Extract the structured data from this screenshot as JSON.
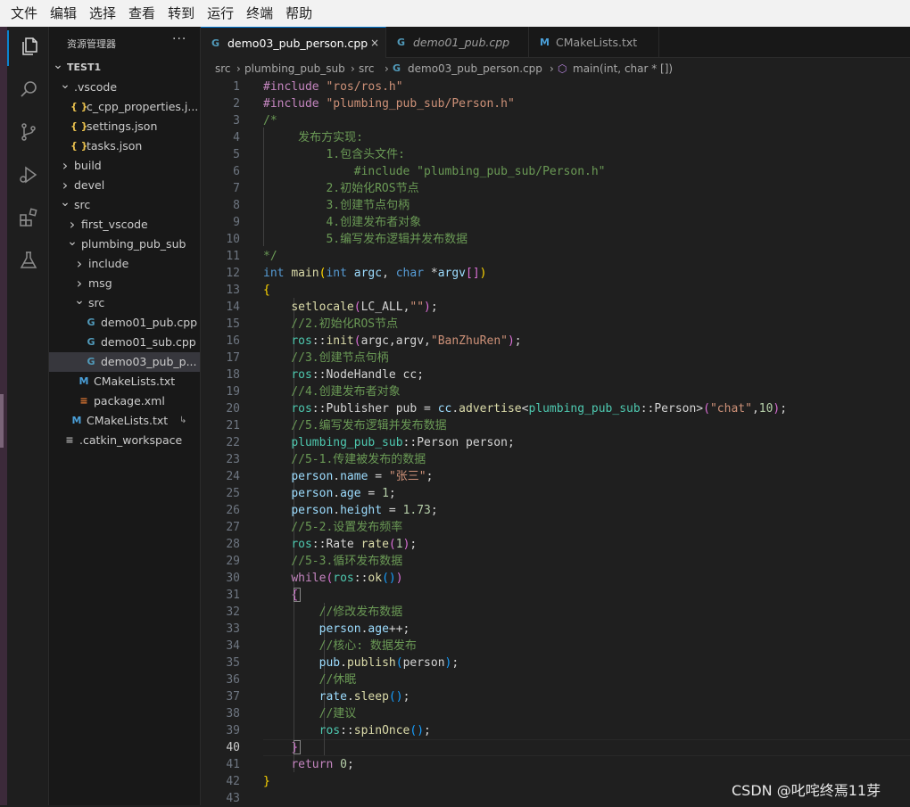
{
  "menu": [
    "文件",
    "编辑",
    "选择",
    "查看",
    "转到",
    "运行",
    "终端",
    "帮助"
  ],
  "activity": [
    "explorer-icon",
    "search-icon",
    "source-control-icon",
    "run-debug-icon",
    "extensions-icon",
    "testing-icon"
  ],
  "sidebar": {
    "title": "资源管理器",
    "more": "···",
    "tree": [
      {
        "label": "TEST1",
        "depth": 0,
        "kind": "folder-open",
        "bold": true
      },
      {
        "label": ".vscode",
        "depth": 1,
        "kind": "folder-open"
      },
      {
        "label": "c_cpp_properties.j...",
        "depth": 2,
        "kind": "json"
      },
      {
        "label": "settings.json",
        "depth": 2,
        "kind": "json"
      },
      {
        "label": "tasks.json",
        "depth": 2,
        "kind": "json"
      },
      {
        "label": "build",
        "depth": 1,
        "kind": "folder"
      },
      {
        "label": "devel",
        "depth": 1,
        "kind": "folder"
      },
      {
        "label": "src",
        "depth": 1,
        "kind": "folder-open"
      },
      {
        "label": "first_vscode",
        "depth": 2,
        "kind": "folder"
      },
      {
        "label": "plumbing_pub_sub",
        "depth": 2,
        "kind": "folder-open"
      },
      {
        "label": "include",
        "depth": 3,
        "kind": "folder"
      },
      {
        "label": "msg",
        "depth": 3,
        "kind": "folder"
      },
      {
        "label": "src",
        "depth": 3,
        "kind": "folder-open"
      },
      {
        "label": "demo01_pub.cpp",
        "depth": 4,
        "kind": "cpp"
      },
      {
        "label": "demo01_sub.cpp",
        "depth": 4,
        "kind": "cpp"
      },
      {
        "label": "demo03_pub_p...",
        "depth": 4,
        "kind": "cpp",
        "selected": true
      },
      {
        "label": "CMakeLists.txt",
        "depth": 3,
        "kind": "cmake"
      },
      {
        "label": "package.xml",
        "depth": 3,
        "kind": "rss"
      },
      {
        "label": "CMakeLists.txt",
        "depth": 2,
        "kind": "cmake",
        "link": true
      },
      {
        "label": ".catkin_workspace",
        "depth": 1,
        "kind": "text"
      }
    ]
  },
  "tabs": [
    {
      "label": "demo03_pub_person.cpp",
      "icon": "cpp",
      "active": true,
      "close": "×"
    },
    {
      "label": "demo01_pub.cpp",
      "icon": "cpp",
      "italic": true
    },
    {
      "label": "CMakeLists.txt",
      "icon": "cmake"
    }
  ],
  "breadcrumb": [
    "src",
    "plumbing_pub_sub",
    "src",
    "demo03_pub_person.cpp",
    "main(int, char * [])"
  ],
  "current_line": 40,
  "code": [
    [
      [
        "#include ",
        "#c586c0"
      ],
      [
        "\"ros/ros.h\"",
        "#ce9178"
      ]
    ],
    [
      [
        "#include ",
        "#c586c0"
      ],
      [
        "\"plumbing_pub_sub/Person.h\"",
        "#ce9178"
      ]
    ],
    [
      [
        "/*",
        "#6a9955"
      ]
    ],
    [
      [
        "     发布方实现:",
        "#6a9955"
      ]
    ],
    [
      [
        "         1.包含头文件:",
        "#6a9955"
      ]
    ],
    [
      [
        "             #include \"plumbing_pub_sub/Person.h\"",
        "#6a9955"
      ]
    ],
    [
      [
        "         2.初始化ROS节点",
        "#6a9955"
      ]
    ],
    [
      [
        "         3.创建节点句柄",
        "#6a9955"
      ]
    ],
    [
      [
        "         4.创建发布者对象",
        "#6a9955"
      ]
    ],
    [
      [
        "         5.编写发布逻辑并发布数据",
        "#6a9955"
      ]
    ],
    [
      [
        "*/",
        "#6a9955"
      ]
    ],
    [
      [
        "int ",
        "#569cd6"
      ],
      [
        "main",
        "#dcdcaa"
      ],
      [
        "(",
        "#ffd700"
      ],
      [
        "int ",
        "#569cd6"
      ],
      [
        "argc",
        "#9cdcfe"
      ],
      [
        ", ",
        "#d4d4d4"
      ],
      [
        "char ",
        "#569cd6"
      ],
      [
        "*",
        "#d4d4d4"
      ],
      [
        "argv",
        "#9cdcfe"
      ],
      [
        "[]",
        "#da70d6"
      ],
      [
        ")",
        "#ffd700"
      ]
    ],
    [
      [
        "{",
        "#ffd700"
      ]
    ],
    [
      [
        "    ",
        "#d4d4d4"
      ],
      [
        "setlocale",
        "#dcdcaa"
      ],
      [
        "(",
        "#da70d6"
      ],
      [
        "LC_ALL",
        "#d4d4d4"
      ],
      [
        ",",
        "#d4d4d4"
      ],
      [
        "\"\"",
        "#ce9178"
      ],
      [
        ")",
        "#da70d6"
      ],
      [
        ";",
        "#d4d4d4"
      ]
    ],
    [
      [
        "    //2.初始化ROS节点",
        "#6a9955"
      ]
    ],
    [
      [
        "    ",
        "#d4d4d4"
      ],
      [
        "ros",
        "#4ec9b0"
      ],
      [
        "::",
        "#d4d4d4"
      ],
      [
        "init",
        "#dcdcaa"
      ],
      [
        "(",
        "#da70d6"
      ],
      [
        "argc,argv,",
        "#d4d4d4"
      ],
      [
        "\"BanZhuRen\"",
        "#ce9178"
      ],
      [
        ")",
        "#da70d6"
      ],
      [
        ";",
        "#d4d4d4"
      ]
    ],
    [
      [
        "    //3.创建节点句柄",
        "#6a9955"
      ]
    ],
    [
      [
        "    ",
        "#d4d4d4"
      ],
      [
        "ros",
        "#4ec9b0"
      ],
      [
        "::NodeHandle cc;",
        "#d4d4d4"
      ]
    ],
    [
      [
        "    //4.创建发布者对象",
        "#6a9955"
      ]
    ],
    [
      [
        "    ",
        "#d4d4d4"
      ],
      [
        "ros",
        "#4ec9b0"
      ],
      [
        "::Publisher pub = ",
        "#d4d4d4"
      ],
      [
        "cc",
        "#9cdcfe"
      ],
      [
        ".",
        "#d4d4d4"
      ],
      [
        "advertise",
        "#dcdcaa"
      ],
      [
        "<",
        "#d4d4d4"
      ],
      [
        "plumbing_pub_sub",
        "#4ec9b0"
      ],
      [
        "::Person>",
        "#d4d4d4"
      ],
      [
        "(",
        "#da70d6"
      ],
      [
        "\"chat\"",
        "#ce9178"
      ],
      [
        ",",
        "#d4d4d4"
      ],
      [
        "10",
        "#b5cea8"
      ],
      [
        ")",
        "#da70d6"
      ],
      [
        ";",
        "#d4d4d4"
      ]
    ],
    [
      [
        "    //5.编写发布逻辑并发布数据",
        "#6a9955"
      ]
    ],
    [
      [
        "    ",
        "#d4d4d4"
      ],
      [
        "plumbing_pub_sub",
        "#4ec9b0"
      ],
      [
        "::Person person;",
        "#d4d4d4"
      ]
    ],
    [
      [
        "    //5-1.传建被发布的数据",
        "#6a9955"
      ]
    ],
    [
      [
        "    ",
        "#d4d4d4"
      ],
      [
        "person",
        "#9cdcfe"
      ],
      [
        ".",
        "#d4d4d4"
      ],
      [
        "name",
        "#9cdcfe"
      ],
      [
        " = ",
        "#d4d4d4"
      ],
      [
        "\"张三\"",
        "#ce9178"
      ],
      [
        ";",
        "#d4d4d4"
      ]
    ],
    [
      [
        "    ",
        "#d4d4d4"
      ],
      [
        "person",
        "#9cdcfe"
      ],
      [
        ".",
        "#d4d4d4"
      ],
      [
        "age",
        "#9cdcfe"
      ],
      [
        " = ",
        "#d4d4d4"
      ],
      [
        "1",
        "#b5cea8"
      ],
      [
        ";",
        "#d4d4d4"
      ]
    ],
    [
      [
        "    ",
        "#d4d4d4"
      ],
      [
        "person",
        "#9cdcfe"
      ],
      [
        ".",
        "#d4d4d4"
      ],
      [
        "height",
        "#9cdcfe"
      ],
      [
        " = ",
        "#d4d4d4"
      ],
      [
        "1.73",
        "#b5cea8"
      ],
      [
        ";",
        "#d4d4d4"
      ]
    ],
    [
      [
        "    //5-2.设置发布频率",
        "#6a9955"
      ]
    ],
    [
      [
        "    ",
        "#d4d4d4"
      ],
      [
        "ros",
        "#4ec9b0"
      ],
      [
        "::Rate ",
        "#d4d4d4"
      ],
      [
        "rate",
        "#dcdcaa"
      ],
      [
        "(",
        "#da70d6"
      ],
      [
        "1",
        "#b5cea8"
      ],
      [
        ")",
        "#da70d6"
      ],
      [
        ";",
        "#d4d4d4"
      ]
    ],
    [
      [
        "    //5-3.循环发布数据",
        "#6a9955"
      ]
    ],
    [
      [
        "    ",
        "#d4d4d4"
      ],
      [
        "while",
        "#c586c0"
      ],
      [
        "(",
        "#da70d6"
      ],
      [
        "ros",
        "#4ec9b0"
      ],
      [
        "::",
        "#d4d4d4"
      ],
      [
        "ok",
        "#dcdcaa"
      ],
      [
        "()",
        "#179fff"
      ],
      [
        ")",
        "#da70d6"
      ]
    ],
    [
      [
        "    ",
        "#d4d4d4"
      ],
      [
        "{",
        "#da70d6"
      ]
    ],
    [
      [
        "        //修改发布数据",
        "#6a9955"
      ]
    ],
    [
      [
        "        ",
        "#d4d4d4"
      ],
      [
        "person",
        "#9cdcfe"
      ],
      [
        ".",
        "#d4d4d4"
      ],
      [
        "age",
        "#9cdcfe"
      ],
      [
        "++;",
        "#d4d4d4"
      ]
    ],
    [
      [
        "        //核心: 数据发布",
        "#6a9955"
      ]
    ],
    [
      [
        "        ",
        "#d4d4d4"
      ],
      [
        "pub",
        "#9cdcfe"
      ],
      [
        ".",
        "#d4d4d4"
      ],
      [
        "publish",
        "#dcdcaa"
      ],
      [
        "(",
        "#179fff"
      ],
      [
        "person",
        "#d4d4d4"
      ],
      [
        ")",
        "#179fff"
      ],
      [
        ";",
        "#d4d4d4"
      ]
    ],
    [
      [
        "        //休眠",
        "#6a9955"
      ]
    ],
    [
      [
        "        ",
        "#d4d4d4"
      ],
      [
        "rate",
        "#9cdcfe"
      ],
      [
        ".",
        "#d4d4d4"
      ],
      [
        "sleep",
        "#dcdcaa"
      ],
      [
        "()",
        "#179fff"
      ],
      [
        ";",
        "#d4d4d4"
      ]
    ],
    [
      [
        "        //建议",
        "#6a9955"
      ]
    ],
    [
      [
        "        ",
        "#d4d4d4"
      ],
      [
        "ros",
        "#4ec9b0"
      ],
      [
        "::",
        "#d4d4d4"
      ],
      [
        "spinOnce",
        "#dcdcaa"
      ],
      [
        "()",
        "#179fff"
      ],
      [
        ";",
        "#d4d4d4"
      ]
    ],
    [
      [
        "    ",
        "#d4d4d4"
      ],
      [
        "}",
        "#da70d6"
      ]
    ],
    [
      [
        "    ",
        "#d4d4d4"
      ],
      [
        "return ",
        "#c586c0"
      ],
      [
        "0",
        "#b5cea8"
      ],
      [
        ";",
        "#d4d4d4"
      ]
    ],
    [
      [
        "}",
        "#ffd700"
      ]
    ],
    []
  ],
  "watermark": "CSDN @叱咤终焉11芽"
}
